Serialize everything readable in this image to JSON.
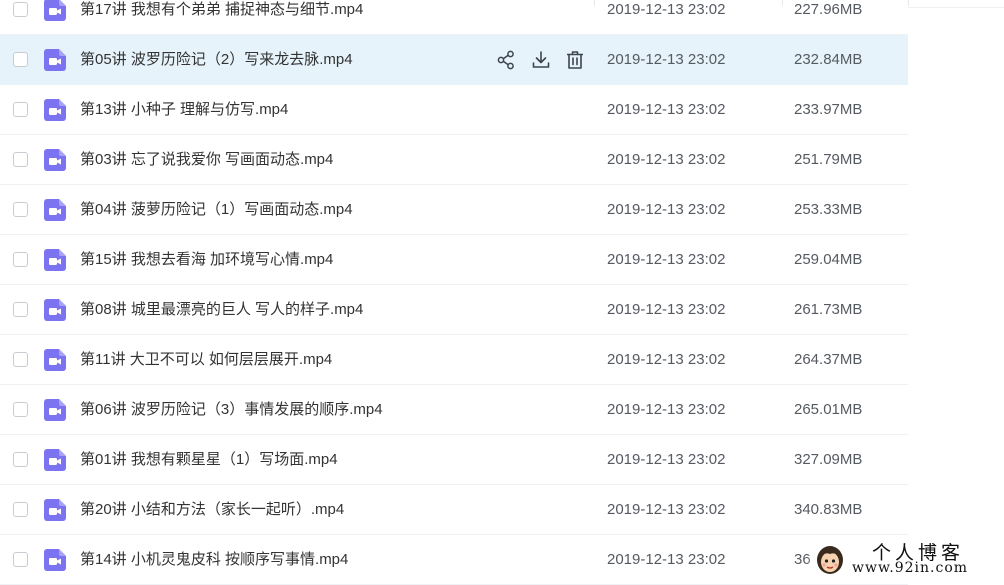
{
  "files": [
    {
      "name": "第17讲 我想有个弟弟 捕捉神态与细节.mp4",
      "date": "2019-12-13 23:02",
      "size": "227.96MB"
    },
    {
      "name": "第05讲 波罗历险记（2）写来龙去脉.mp4",
      "date": "2019-12-13 23:02",
      "size": "232.84MB"
    },
    {
      "name": "第13讲 小种子 理解与仿写.mp4",
      "date": "2019-12-13 23:02",
      "size": "233.97MB"
    },
    {
      "name": "第03讲 忘了说我爱你 写画面动态.mp4",
      "date": "2019-12-13 23:02",
      "size": "251.79MB"
    },
    {
      "name": "第04讲 菠萝历险记（1）写画面动态.mp4",
      "date": "2019-12-13 23:02",
      "size": "253.33MB"
    },
    {
      "name": "第15讲 我想去看海 加环境写心情.mp4",
      "date": "2019-12-13 23:02",
      "size": "259.04MB"
    },
    {
      "name": "第08讲 城里最漂亮的巨人  写人的样子.mp4",
      "date": "2019-12-13 23:02",
      "size": "261.73MB"
    },
    {
      "name": "第11讲 大卫不可以 如何层层展开.mp4",
      "date": "2019-12-13 23:02",
      "size": "264.37MB"
    },
    {
      "name": "第06讲 波罗历险记（3）事情发展的顺序.mp4",
      "date": "2019-12-13 23:02",
      "size": "265.01MB"
    },
    {
      "name": "第01讲 我想有颗星星（1）写场面.mp4",
      "date": "2019-12-13 23:02",
      "size": "327.09MB"
    },
    {
      "name": "第20讲 小结和方法（家长一起听）.mp4",
      "date": "2019-12-13 23:02",
      "size": "340.83MB"
    },
    {
      "name": "第14讲 小机灵鬼皮科 按顺序写事情.mp4",
      "date": "2019-12-13 23:02",
      "size": "36"
    }
  ],
  "hover_row_index": 1,
  "row_actions": [
    "share-icon",
    "download-icon",
    "delete-icon"
  ],
  "icons": {
    "file": "video-file-icon"
  },
  "colors": {
    "accent": "#06a7ff",
    "hover_bg": "#e6f3fb",
    "video_icon": "#7c73f0",
    "text_primary": "#333333",
    "text_secondary": "#555a61"
  },
  "watermark": {
    "title": "个人博客",
    "url": "www.92in.com"
  }
}
